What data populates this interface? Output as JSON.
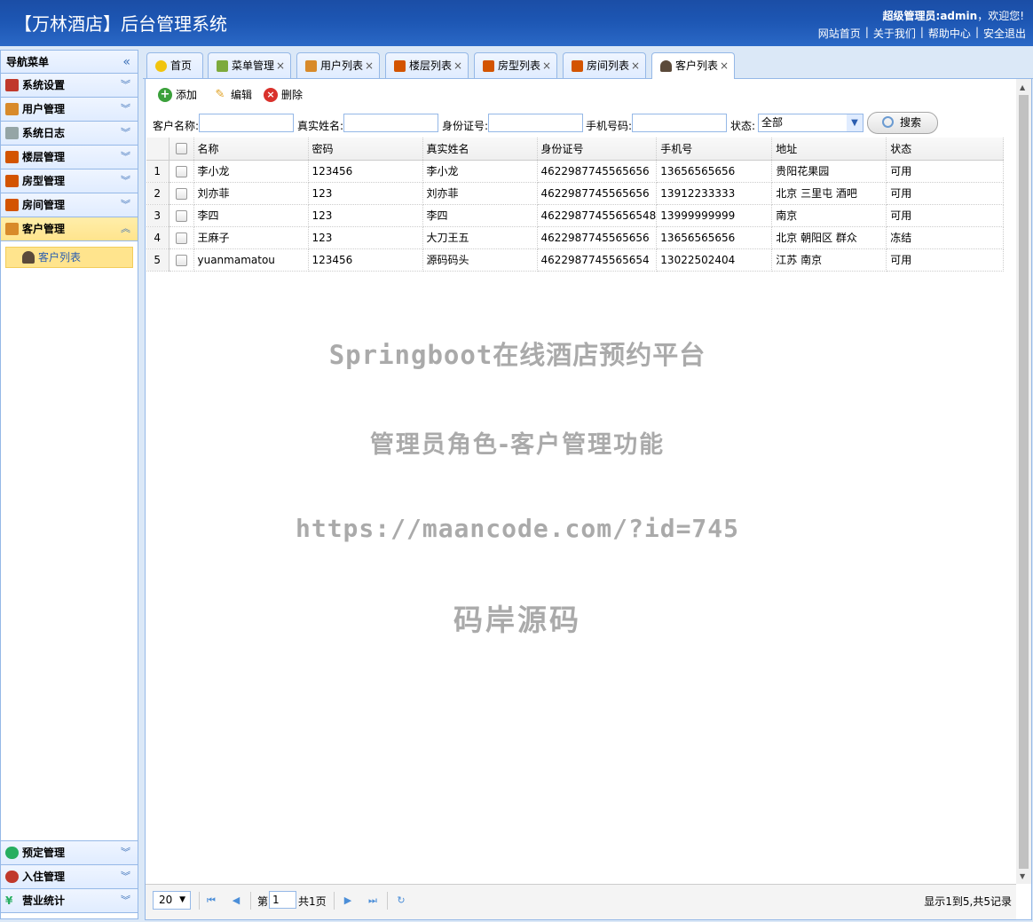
{
  "header": {
    "title": "【万林酒店】后台管理系统",
    "welcome_role": "超级管理员:admin",
    "welcome_suffix": "，欢迎您!",
    "links": [
      "网站首页",
      "关于我们",
      "帮助中心",
      "安全退出"
    ]
  },
  "sidebar": {
    "heading": "导航菜单",
    "top_items": [
      {
        "label": "系统设置",
        "icon": "tools-icon",
        "color": "#c0392b"
      },
      {
        "label": "用户管理",
        "icon": "users-icon",
        "color": "#d88a2a"
      },
      {
        "label": "系统日志",
        "icon": "log-icon",
        "color": "#7f8c8d"
      },
      {
        "label": "楼层管理",
        "icon": "house-icon",
        "color": "#d35400"
      },
      {
        "label": "房型管理",
        "icon": "house-icon",
        "color": "#d35400"
      },
      {
        "label": "房间管理",
        "icon": "house-icon",
        "color": "#d35400"
      },
      {
        "label": "客户管理",
        "icon": "users-icon",
        "color": "#d88a2a"
      }
    ],
    "active_sub": "客户列表",
    "bottom_items": [
      {
        "label": "预定管理",
        "icon": "clock-icon",
        "color": "#27ae60"
      },
      {
        "label": "入住管理",
        "icon": "checkin-icon",
        "color": "#c0392b"
      },
      {
        "label": "营业统计",
        "icon": "yen-icon",
        "color": "#27ae60"
      }
    ]
  },
  "tabs": [
    {
      "label": "首页",
      "closable": false,
      "icon": "bulb-icon"
    },
    {
      "label": "菜单管理",
      "closable": true,
      "icon": "tree-icon"
    },
    {
      "label": "用户列表",
      "closable": true,
      "icon": "users-icon"
    },
    {
      "label": "楼层列表",
      "closable": true,
      "icon": "house-icon"
    },
    {
      "label": "房型列表",
      "closable": true,
      "icon": "house-icon"
    },
    {
      "label": "房间列表",
      "closable": true,
      "icon": "house-icon"
    },
    {
      "label": "客户列表",
      "closable": true,
      "icon": "user-icon"
    }
  ],
  "toolbar": {
    "add": "添加",
    "edit": "编辑",
    "delete": "删除"
  },
  "search": {
    "name_label": "客户名称:",
    "realname_label": "真实姓名:",
    "idcard_label": "身份证号:",
    "phone_label": "手机号码:",
    "status_label": "状态:",
    "status_value": "全部",
    "button": "搜索"
  },
  "grid": {
    "columns": [
      "名称",
      "密码",
      "真实姓名",
      "身份证号",
      "手机号",
      "地址",
      "状态"
    ],
    "rows": [
      [
        "1",
        "李小龙",
        "123456",
        "李小龙",
        "4622987745565656",
        "13656565656",
        "贵阳花果园",
        "可用"
      ],
      [
        "2",
        "刘亦菲",
        "123",
        "刘亦菲",
        "4622987745565656",
        "13912233333",
        "北京 三里屯 酒吧",
        "可用"
      ],
      [
        "3",
        "李四",
        "123",
        "李四",
        "46229877455656548",
        "13999999999",
        "南京",
        "可用"
      ],
      [
        "4",
        "王麻子",
        "123",
        "大刀王五",
        "4622987745565656",
        "13656565656",
        "北京 朝阳区 群众",
        "冻结"
      ],
      [
        "5",
        "yuanmamatou",
        "123456",
        "源码码头",
        "4622987745565654",
        "13022502404",
        "江苏 南京",
        "可用"
      ]
    ]
  },
  "watermark": {
    "line1": "Springboot在线酒店预约平台",
    "line2": "管理员角色-客户管理功能",
    "line3": "https://maancode.com/?id=745",
    "line4": "码岸源码"
  },
  "pager": {
    "page_size": "20",
    "page_prefix": "第",
    "page_value": "1",
    "page_total": "共1页",
    "info": "显示1到5,共5记录"
  }
}
